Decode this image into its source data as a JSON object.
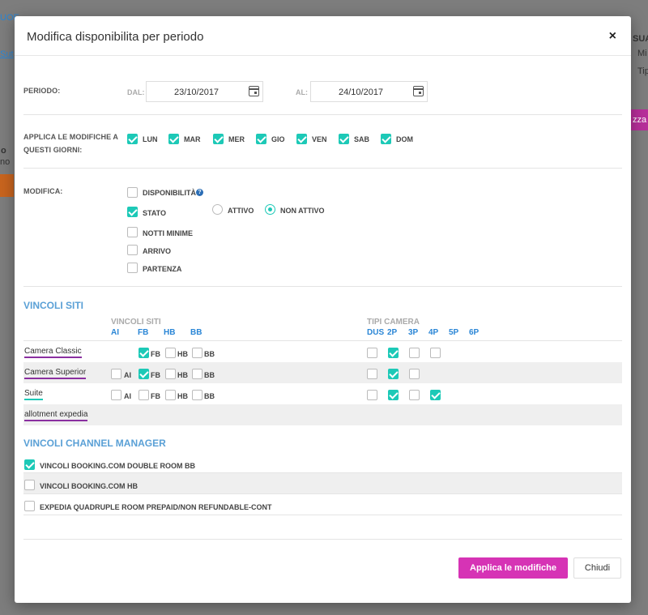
{
  "background": {
    "frag_top": "UOE",
    "frag_sut": "Sut",
    "frag_sua": "SUA",
    "frag_min": "Mi",
    "frag_tip": "Tip",
    "frag_o": "o",
    "frag_no": "no",
    "frag_zza": "zza"
  },
  "modal": {
    "title": "Modifica disponibilita per periodo",
    "close": "×"
  },
  "periodo": {
    "label": "PERIODO:",
    "dal_label": "DAL:",
    "dal_value": "23/10/2017",
    "al_label": "AL:",
    "al_value": "24/10/2017"
  },
  "giorni": {
    "label_line1": "APPLICA LE MODIFICHE A",
    "label_line2": "QUESTI GIORNI:",
    "days": [
      {
        "label": "LUN",
        "checked": true
      },
      {
        "label": "MAR",
        "checked": true
      },
      {
        "label": "MER",
        "checked": true
      },
      {
        "label": "GIO",
        "checked": true
      },
      {
        "label": "VEN",
        "checked": true
      },
      {
        "label": "SAB",
        "checked": true
      },
      {
        "label": "DOM",
        "checked": true
      }
    ]
  },
  "modifica": {
    "label": "MODIFICA:",
    "disponibilita": "DISPONIBILITÀ",
    "stato": "STATO",
    "attivo": "ATTIVO",
    "non_attivo": "NON ATTIVO",
    "notti_minime": "NOTTI MINIME",
    "arrivo": "ARRIVO",
    "partenza": "PARTENZA",
    "help": "?"
  },
  "vincoli_siti": {
    "title": "VINCOLI SITI",
    "group_label": "VINCOLI SITI",
    "tipi_label": "TIPI CAMERA",
    "site_cols": [
      "AI",
      "FB",
      "HB",
      "BB"
    ],
    "room_cols": [
      "DUS",
      "2P",
      "3P",
      "4P",
      "5P",
      "6P"
    ],
    "rows": [
      {
        "name": "Camera Classic",
        "ai": null,
        "fb": true,
        "hb": false,
        "bb": false,
        "rooms": [
          false,
          true,
          false,
          false
        ]
      },
      {
        "name": "Camera Superior",
        "ai": false,
        "fb": true,
        "hb": false,
        "bb": false,
        "rooms": [
          false,
          true,
          false
        ]
      },
      {
        "name": "Suite",
        "ai": false,
        "fb": false,
        "hb": false,
        "bb": false,
        "rooms": [
          false,
          true,
          false,
          true
        ]
      },
      {
        "name": "allotment expedia"
      }
    ]
  },
  "vincoli_channel": {
    "title": "VINCOLI CHANNEL MANAGER",
    "items": [
      {
        "label": "VINCOLI BOOKING.COM DOUBLE ROOM BB",
        "checked": true
      },
      {
        "label": "VINCOLI BOOKING.COM HB",
        "checked": false
      },
      {
        "label": "EXPEDIA QUADRUPLE ROOM PREPAID/NON REFUNDABLE-CONT",
        "checked": false
      }
    ]
  },
  "footer": {
    "apply": "Applica le modifiche",
    "close": "Chiudi"
  },
  "colors": {
    "accent": "#1dc9b7",
    "primary_button": "#d633b5",
    "section_title": "#5aa0d6",
    "column_head": "#2a86d6"
  }
}
